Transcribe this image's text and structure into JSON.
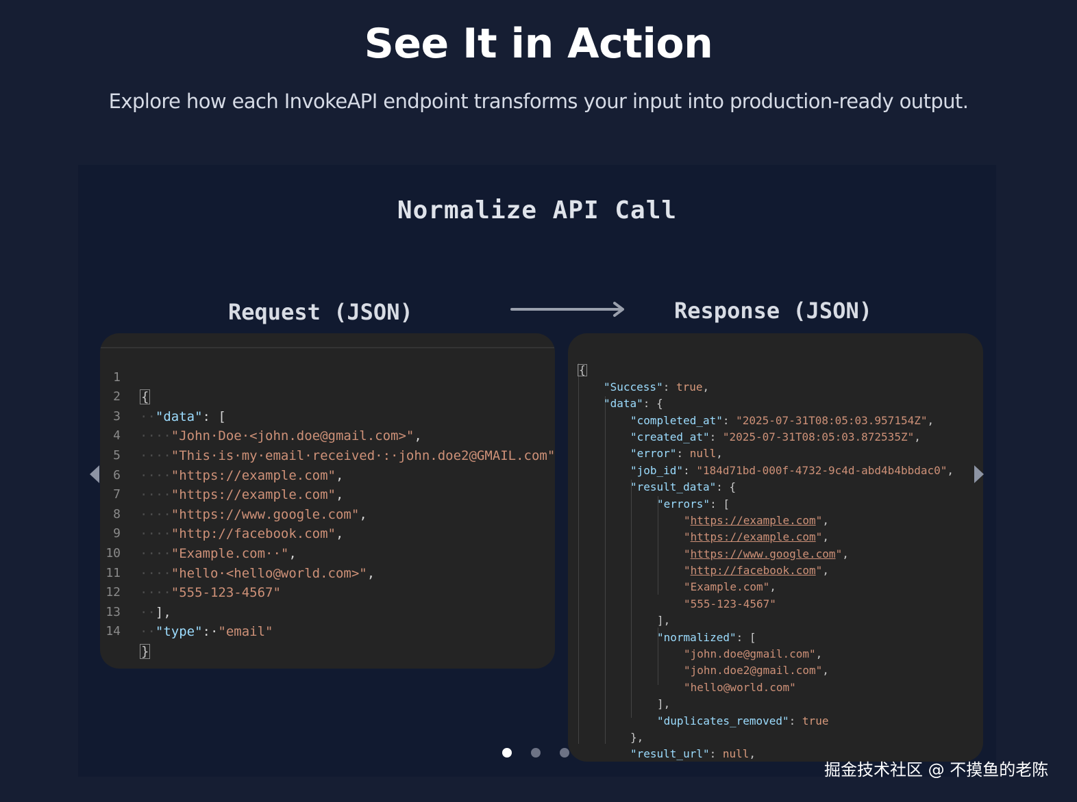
{
  "hero": {
    "title": "See It in Action",
    "subtitle": "Explore how each InvokeAPI endpoint transforms your input into production-ready output."
  },
  "slide": {
    "title": "Normalize API Call",
    "request_label": "Request (JSON)",
    "response_label": "Response (JSON)"
  },
  "request_code": {
    "line_numbers": [
      "1",
      "2",
      "3",
      "4",
      "5",
      "6",
      "7",
      "8",
      "9",
      "10",
      "11",
      "12",
      "13",
      "14"
    ],
    "open_brace": "{",
    "data_key": "\"data\"",
    "data_open": ": [",
    "items": [
      "\"John·Doe·<john.doe@gmail.com>\"",
      "\"This·is·my·email·received·:·john.doe2@GMAIL.com\"",
      "\"https://example.com\"",
      "\"https://example.com\"",
      "\"https://www.google.com\"",
      "\"http://facebook.com\"",
      "\"Example.com··\"",
      "\"hello·<hello@world.com>\"",
      "\"555-123-4567\""
    ],
    "array_close": "],",
    "type_key": "\"type\"",
    "type_sep": ":·",
    "type_value": "\"email\"",
    "close_brace": "}"
  },
  "response_code": {
    "open_brace": "{",
    "success_key": "\"Success\"",
    "success_value": "true",
    "data_key": "\"data\"",
    "completed_at_key": "\"completed_at\"",
    "completed_at_value": "\"2025-07-31T08:05:03.957154Z\"",
    "created_at_key": "\"created_at\"",
    "created_at_value": "\"2025-07-31T08:05:03.872535Z\"",
    "error_key": "\"error\"",
    "error_value": "null",
    "job_id_key": "\"job_id\"",
    "job_id_value": "\"184d71bd-000f-4732-9c4d-abd4b4bbdac0\"",
    "result_data_key": "\"result_data\"",
    "errors_key": "\"errors\"",
    "error_links": [
      "https://example.com",
      "https://example.com",
      "https://www.google.com",
      "http://facebook.com"
    ],
    "error_plain": [
      "\"Example.com\"",
      "\"555-123-4567\""
    ],
    "normalized_key": "\"normalized\"",
    "normalized": [
      "\"john.doe@gmail.com\"",
      "\"john.doe2@gmail.com\"",
      "\"hello@world.com\""
    ],
    "duplicates_removed_key": "\"duplicates_removed\"",
    "duplicates_removed_value": "true",
    "result_url_key": "\"result_url\"",
    "result_url_value": "null"
  },
  "carousel": {
    "slide_count": 3,
    "active_index": 0
  },
  "watermark": "掘金技术社区 @ 不摸鱼的老陈",
  "colors": {
    "background": "#161e33",
    "card": "#111a30",
    "editor": "#242424",
    "json_key": "#9cdcfe",
    "json_string": "#ce9178"
  }
}
